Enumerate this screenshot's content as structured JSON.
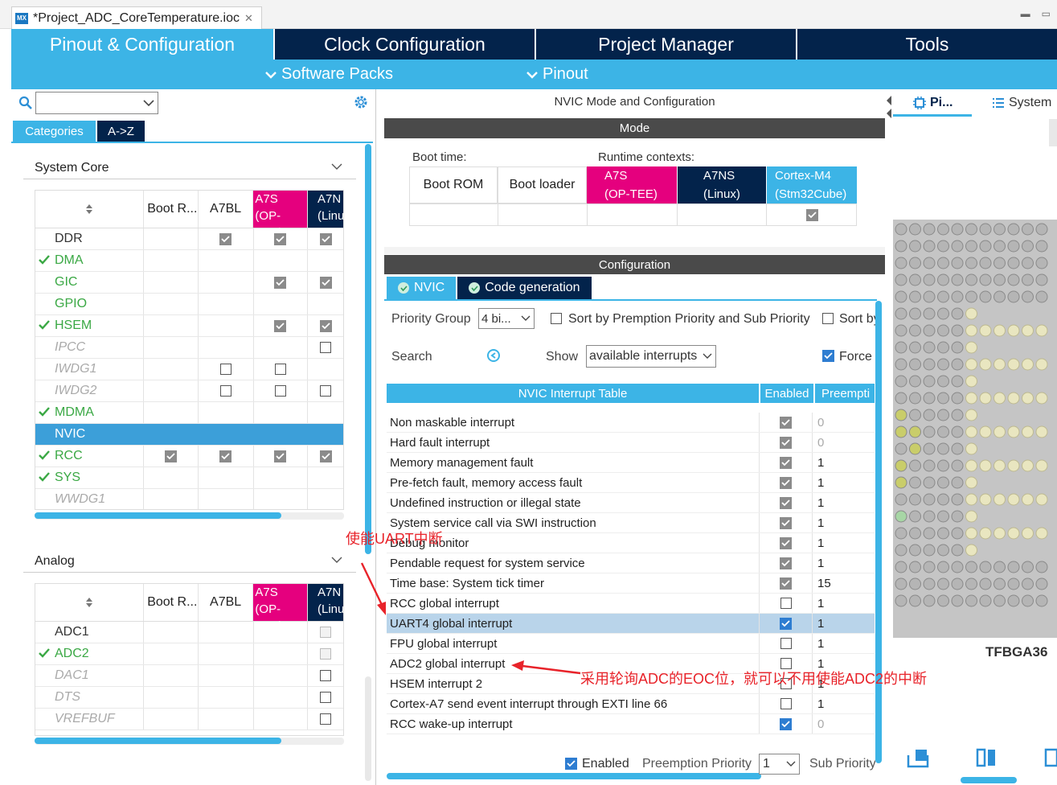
{
  "file_tab": {
    "title": "*Project_ADC_CoreTemperature.ioc",
    "icon_text": "MX"
  },
  "nav": {
    "tabs": [
      "Pinout & Configuration",
      "Clock Configuration",
      "Project Manager",
      "Tools"
    ],
    "active": 0
  },
  "subnav": {
    "software_packs": "Software Packs",
    "pinout": "Pinout"
  },
  "left": {
    "tabs": {
      "categories": "Categories",
      "az": "A->Z"
    },
    "system_core": {
      "title": "System Core",
      "columns": [
        "Boot R...",
        "A7BL",
        "A7S",
        "(OP-TEE)",
        "A7N",
        "(Linu"
      ],
      "rows": [
        {
          "name": "DDR",
          "style": "normal",
          "ok": false,
          "c": [
            "",
            "g",
            "g",
            "g"
          ]
        },
        {
          "name": "DMA",
          "style": "green",
          "ok": true,
          "c": [
            "",
            "",
            "",
            ""
          ]
        },
        {
          "name": "GIC",
          "style": "green",
          "ok": false,
          "c": [
            "",
            "",
            "g",
            "g"
          ]
        },
        {
          "name": "GPIO",
          "style": "green",
          "ok": false,
          "c": [
            "",
            "",
            "",
            ""
          ]
        },
        {
          "name": "HSEM",
          "style": "green",
          "ok": true,
          "c": [
            "",
            "",
            "g",
            "g"
          ]
        },
        {
          "name": "IPCC",
          "style": "italic",
          "ok": false,
          "c": [
            "",
            "",
            "",
            "e"
          ]
        },
        {
          "name": "IWDG1",
          "style": "italic",
          "ok": false,
          "c": [
            "",
            "e",
            "e",
            ""
          ]
        },
        {
          "name": "IWDG2",
          "style": "italic",
          "ok": false,
          "c": [
            "",
            "e",
            "e",
            "e"
          ]
        },
        {
          "name": "MDMA",
          "style": "green",
          "ok": true,
          "c": [
            "",
            "",
            "",
            ""
          ]
        },
        {
          "name": "NVIC",
          "style": "selected",
          "ok": false,
          "c": [
            "",
            "",
            "",
            ""
          ]
        },
        {
          "name": "RCC",
          "style": "green",
          "ok": true,
          "c": [
            "g",
            "g",
            "g",
            "g"
          ]
        },
        {
          "name": "SYS",
          "style": "green",
          "ok": true,
          "c": [
            "",
            "",
            "",
            ""
          ]
        },
        {
          "name": "WWDG1",
          "style": "italic",
          "ok": false,
          "c": [
            "",
            "",
            "",
            ""
          ]
        }
      ]
    },
    "analog": {
      "title": "Analog",
      "rows": [
        {
          "name": "ADC1",
          "style": "normal",
          "ok": false,
          "c": [
            "",
            "",
            "",
            "d"
          ]
        },
        {
          "name": "ADC2",
          "style": "green",
          "ok": true,
          "c": [
            "",
            "",
            "",
            "d"
          ]
        },
        {
          "name": "DAC1",
          "style": "italic",
          "ok": false,
          "c": [
            "",
            "",
            "",
            "e"
          ]
        },
        {
          "name": "DTS",
          "style": "italic",
          "ok": false,
          "c": [
            "",
            "",
            "",
            "e"
          ]
        },
        {
          "name": "VREFBUF",
          "style": "italic",
          "ok": false,
          "c": [
            "",
            "",
            "",
            "e"
          ]
        }
      ]
    }
  },
  "mode": {
    "panel_title": "NVIC Mode and Configuration",
    "bar": "Mode",
    "boot_time": "Boot time:",
    "runtime": "Runtime contexts:",
    "boot_rom": "Boot ROM",
    "boot_loader": "Boot loader",
    "a7s": "A7S",
    "a7s_sub": "(OP-TEE)",
    "a7ns": "A7NS",
    "a7ns_sub": "(Linux)",
    "cm4": "Cortex-M4",
    "cm4_sub": "(Stm32Cube)"
  },
  "config": {
    "bar": "Configuration",
    "tab_nvic": "NVIC",
    "tab_codegen": "Code generation",
    "priority_group_label": "Priority Group",
    "priority_group_value": "4 bi...",
    "sort_label": "Sort by Premption Priority and Sub Priority",
    "sort_by": "Sort by",
    "search_label": "Search",
    "show_label": "Show",
    "show_value": "available interrupts",
    "force": "Force",
    "table_header": "NVIC Interrupt Table",
    "enabled_header": "Enabled",
    "preempt_header": "Preempti",
    "rows": [
      {
        "name": "Non maskable interrupt",
        "en": "g",
        "p": "0",
        "pg": true
      },
      {
        "name": "Hard fault interrupt",
        "en": "g",
        "p": "0",
        "pg": true
      },
      {
        "name": "Memory management fault",
        "en": "g",
        "p": "1",
        "pg": false
      },
      {
        "name": "Pre-fetch fault, memory access fault",
        "en": "g",
        "p": "1",
        "pg": false
      },
      {
        "name": "Undefined instruction or illegal state",
        "en": "g",
        "p": "1",
        "pg": false
      },
      {
        "name": "System service call via SWI instruction",
        "en": "g",
        "p": "1",
        "pg": false
      },
      {
        "name": "Debug monitor",
        "en": "g",
        "p": "1",
        "pg": false
      },
      {
        "name": "Pendable request for system service",
        "en": "g",
        "p": "1",
        "pg": false
      },
      {
        "name": "Time base: System tick timer",
        "en": "g",
        "p": "15",
        "pg": false
      },
      {
        "name": "RCC global interrupt",
        "en": "e",
        "p": "1",
        "pg": false
      },
      {
        "name": "UART4 global interrupt",
        "en": "b",
        "p": "1",
        "pg": false,
        "sel": true
      },
      {
        "name": "FPU global interrupt",
        "en": "e",
        "p": "1",
        "pg": false
      },
      {
        "name": "ADC2 global interrupt",
        "en": "e",
        "p": "1",
        "pg": false
      },
      {
        "name": "HSEM interrupt 2",
        "en": "e",
        "p": "1",
        "pg": false
      },
      {
        "name": "Cortex-A7 send event interrupt through EXTI line 66",
        "en": "e",
        "p": "1",
        "pg": false
      },
      {
        "name": "RCC wake-up interrupt",
        "en": "b",
        "p": "0",
        "pg": true
      }
    ],
    "footer_enabled": "Enabled",
    "footer_preemption": "Preemption Priority",
    "footer_preemption_value": "1",
    "footer_sub": "Sub Priority"
  },
  "right": {
    "tab_pinout": "Pi...",
    "tab_system": "System",
    "package": "TFBGA36"
  },
  "annotations": {
    "uart": "使能UART中断",
    "adc": "采用轮询ADC的EOC位，就可以不用使能ADC2的中断"
  },
  "colors": {
    "accent": "#3cb4e6",
    "navy": "#03234b",
    "pink": "#e5007e",
    "red": "#e8232a"
  }
}
